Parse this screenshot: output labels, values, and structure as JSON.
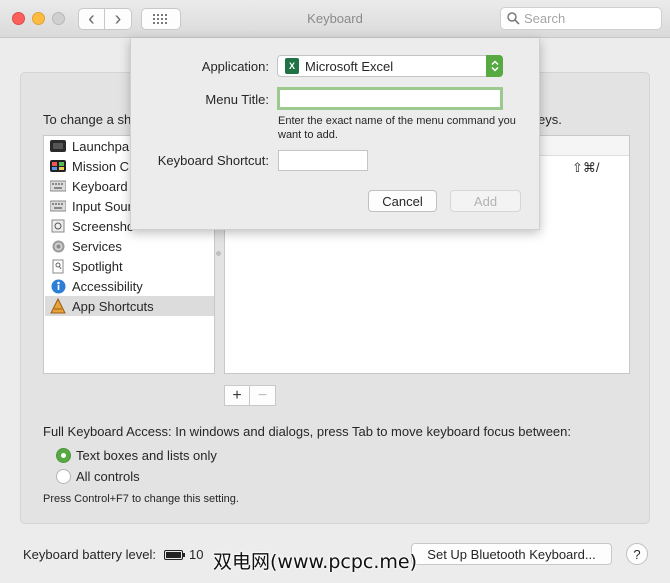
{
  "window": {
    "title": "Keyboard"
  },
  "toolbar": {
    "back_glyph": "‹",
    "forward_glyph": "›",
    "search_placeholder": "Search"
  },
  "main": {
    "intro_start": "To change a sh",
    "intro_end": "eys.",
    "categories": [
      {
        "label": "Launchpa",
        "icon": "launchpad-icon"
      },
      {
        "label": "Mission C",
        "icon": "mission-control-icon"
      },
      {
        "label": "Keyboard",
        "icon": "keyboard-icon"
      },
      {
        "label": "Input Sour",
        "icon": "input-sources-icon"
      },
      {
        "label": "Screensho",
        "icon": "screenshots-icon"
      },
      {
        "label": "Services",
        "icon": "services-gear-icon"
      },
      {
        "label": "Spotlight",
        "icon": "spotlight-icon"
      },
      {
        "label": "Accessibility",
        "icon": "accessibility-icon"
      },
      {
        "label": "App Shortcuts",
        "icon": "app-shortcuts-icon",
        "selected": true
      }
    ],
    "shortcut_keys": "⇧⌘/",
    "add_glyph": "+",
    "remove_glyph": "−",
    "full_keyboard_access": "Full Keyboard Access: In windows and dialogs, press Tab to move keyboard focus between:",
    "radio_options": [
      {
        "label": "Text boxes and lists only",
        "checked": true
      },
      {
        "label": "All controls",
        "checked": false
      }
    ],
    "hint": "Press Control+F7 to change this setting."
  },
  "footer": {
    "battery_label": "Keyboard battery level:",
    "battery_value": "10",
    "setup_button": "Set Up Bluetooth Keyboard...",
    "help_glyph": "?",
    "watermark": "双电网(www.pcpc.me)"
  },
  "sheet": {
    "application_label": "Application:",
    "application_value": "Microsoft Excel",
    "app_icon_letter": "X",
    "menu_title_label": "Menu Title:",
    "menu_title_value": "",
    "menu_hint": "Enter the exact name of the menu command you want to add.",
    "shortcut_label": "Keyboard Shortcut:",
    "shortcut_value": "",
    "cancel_label": "Cancel",
    "add_label": "Add"
  },
  "colors": {
    "accent": "#57a942",
    "focus_ring": "#9cc98e",
    "excel": "#1f7244"
  }
}
